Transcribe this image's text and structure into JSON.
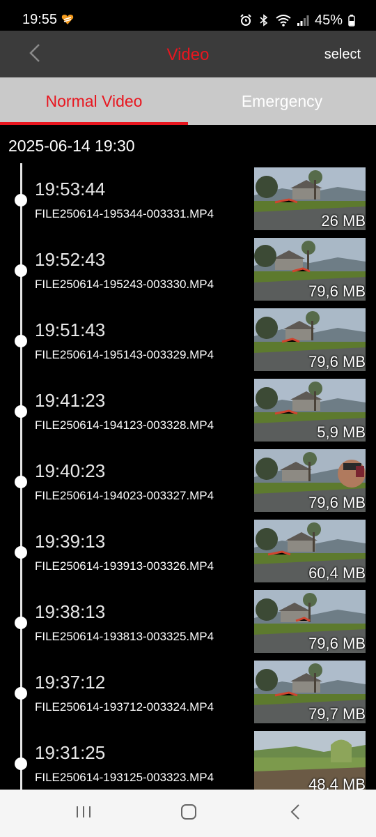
{
  "status_bar": {
    "time": "19:55",
    "battery": "45%"
  },
  "header": {
    "title": "Video",
    "select_label": "select"
  },
  "tabs": [
    {
      "label": "Normal Video",
      "active": true
    },
    {
      "label": "Emergency",
      "active": false
    }
  ],
  "date_group": "2025-06-14 19:30",
  "videos": [
    {
      "time": "19:53:44",
      "filename": "FILE250614-195344-003331.MP4",
      "size": "26 MB"
    },
    {
      "time": "19:52:43",
      "filename": "FILE250614-195243-003330.MP4",
      "size": "79,6 MB"
    },
    {
      "time": "19:51:43",
      "filename": "FILE250614-195143-003329.MP4",
      "size": "79,6 MB"
    },
    {
      "time": "19:41:23",
      "filename": "FILE250614-194123-003328.MP4",
      "size": "5,9 MB"
    },
    {
      "time": "19:40:23",
      "filename": "FILE250614-194023-003327.MP4",
      "size": "79,6 MB"
    },
    {
      "time": "19:39:13",
      "filename": "FILE250614-193913-003326.MP4",
      "size": "60,4 MB"
    },
    {
      "time": "19:38:13",
      "filename": "FILE250614-193813-003325.MP4",
      "size": "79,6 MB"
    },
    {
      "time": "19:37:12",
      "filename": "FILE250614-193712-003324.MP4",
      "size": "79,7 MB"
    },
    {
      "time": "19:31:25",
      "filename": "FILE250614-193125-003323.MP4",
      "size": "48,4 MB"
    }
  ],
  "colors": {
    "accent": "#e8161f",
    "header_bg": "#3b3b3b",
    "tab_bg": "#c9c9c9"
  },
  "icons": {
    "back": "chevron-left-icon",
    "nav_recents": "recents-icon",
    "nav_home": "home-icon",
    "nav_back": "nav-back-icon"
  }
}
